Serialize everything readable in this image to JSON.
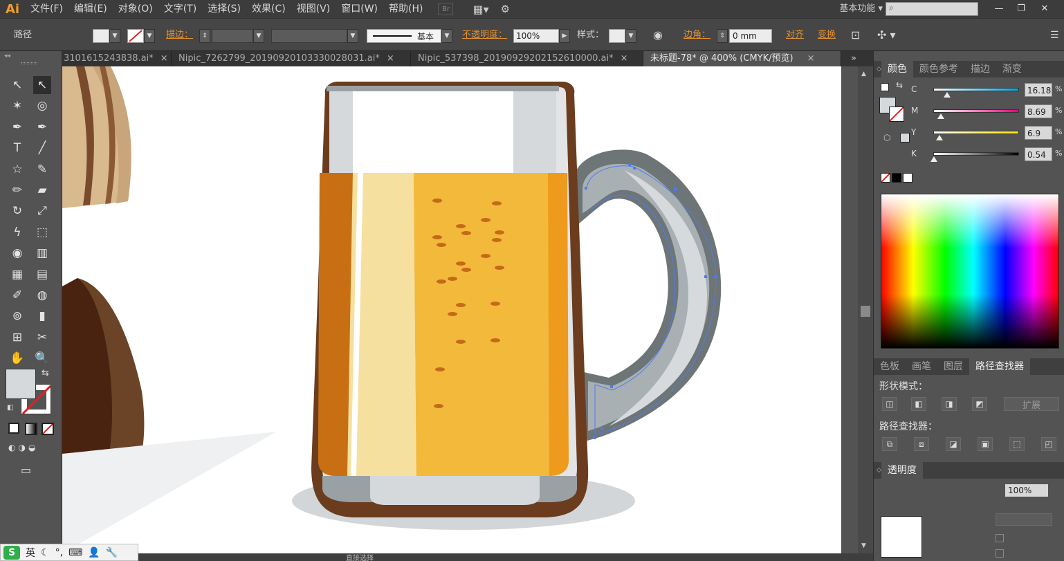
{
  "app": {
    "logo": "Ai",
    "workspace": "基本功能"
  },
  "menu": [
    {
      "label": "文件(F)"
    },
    {
      "label": "编辑(E)"
    },
    {
      "label": "对象(O)"
    },
    {
      "label": "文字(T)"
    },
    {
      "label": "选择(S)"
    },
    {
      "label": "效果(C)"
    },
    {
      "label": "视图(V)"
    },
    {
      "label": "窗口(W)"
    },
    {
      "label": "帮助(H)"
    }
  ],
  "menu_tool_br": "Br",
  "window_controls": {
    "minimize": "—",
    "restore": "❐",
    "close": "✕"
  },
  "control_bar": {
    "selection_label": "路径",
    "stroke_label": "描边：",
    "stroke_style": "基本",
    "opacity_label": "不透明度：",
    "opacity_value": "100%",
    "style_label": "样式：",
    "corner_label": "边角：",
    "corner_value": "0 mm",
    "align_label": "对齐",
    "transform_label": "变换"
  },
  "tabs": [
    {
      "label": "3101615243838.ai*",
      "close": "×"
    },
    {
      "label": "Nipic_7262799_20190920103330028031.ai*",
      "close": "×"
    },
    {
      "label": "Nipic_537398_20190929202152610000.ai*",
      "close": "×"
    },
    {
      "label": "未标题-78* @ 400% (CMYK/预览)",
      "close": "×",
      "active": true
    }
  ],
  "tools": [
    {
      "name": "selection-tool-icon",
      "glyph": "↖"
    },
    {
      "name": "direct-selection-tool-icon",
      "glyph": "↖"
    },
    {
      "name": "magic-wand-tool-icon",
      "glyph": "✶"
    },
    {
      "name": "lasso-tool-icon",
      "glyph": "◎"
    },
    {
      "name": "pen-tool-icon",
      "glyph": "✒"
    },
    {
      "name": "curvature-tool-icon",
      "glyph": "✒"
    },
    {
      "name": "type-tool-icon",
      "glyph": "T"
    },
    {
      "name": "line-tool-icon",
      "glyph": "╱"
    },
    {
      "name": "star-tool-icon",
      "glyph": "☆"
    },
    {
      "name": "paintbrush-tool-icon",
      "glyph": "✎"
    },
    {
      "name": "pencil-tool-icon",
      "glyph": "✏"
    },
    {
      "name": "eraser-tool-icon",
      "glyph": "▰"
    },
    {
      "name": "rotate-tool-icon",
      "glyph": "↻"
    },
    {
      "name": "scale-tool-icon",
      "glyph": "⤢"
    },
    {
      "name": "width-tool-icon",
      "glyph": "ϟ"
    },
    {
      "name": "free-transform-tool-icon",
      "glyph": "⬚"
    },
    {
      "name": "shape-builder-tool-icon",
      "glyph": "◉"
    },
    {
      "name": "graph-tool-icon",
      "glyph": "▥"
    },
    {
      "name": "mesh-tool-icon",
      "glyph": "▦"
    },
    {
      "name": "gradient-tool-icon",
      "glyph": "▤"
    },
    {
      "name": "eyedropper-tool-icon",
      "glyph": "✐"
    },
    {
      "name": "blend-tool-icon",
      "glyph": "◍"
    },
    {
      "name": "symbol-sprayer-tool-icon",
      "glyph": "⊚"
    },
    {
      "name": "column-graph-tool-icon",
      "glyph": "▮"
    },
    {
      "name": "artboard-tool-icon",
      "glyph": "⊞"
    },
    {
      "name": "slice-tool-icon",
      "glyph": "✂"
    },
    {
      "name": "hand-tool-icon",
      "glyph": "✋"
    },
    {
      "name": "zoom-tool-icon",
      "glyph": "🔍"
    }
  ],
  "color_panel": {
    "tabs": [
      "颜色",
      "颜色参考",
      "描边",
      "渐变"
    ],
    "active_tab": "颜色",
    "channels": [
      {
        "label": "C",
        "value": "16.18",
        "fraction": 0.16,
        "gradient": "linear-gradient(to right,#fff,#00a6e6)"
      },
      {
        "label": "M",
        "value": "8.69",
        "fraction": 0.09,
        "gradient": "linear-gradient(to right,#fff,#e6007e)"
      },
      {
        "label": "Y",
        "value": "6.9",
        "fraction": 0.07,
        "gradient": "linear-gradient(to right,#fff,#ffe600)"
      },
      {
        "label": "K",
        "value": "0.54",
        "fraction": 0.01,
        "gradient": "linear-gradient(to right,#fff,#000)"
      }
    ],
    "pct": "%"
  },
  "pathfinder_panel": {
    "tabs": [
      "色板",
      "画笔",
      "图层",
      "路径查找器"
    ],
    "active_tab": "路径查找器",
    "shape_modes_label": "形状模式：",
    "pathfinders_label": "路径查找器：",
    "expand_label": "扩展"
  },
  "transparency_panel": {
    "title": "透明度",
    "opacity": "100%"
  },
  "status": {
    "text": "直接选择"
  },
  "ime": {
    "logo": "S",
    "lang": "英"
  },
  "colors": {
    "beer_dark": "#c86f14",
    "beer_mid": "#ee9a1c",
    "beer_light": "#f6e0a0",
    "beer_center": "#f3b93a",
    "glass_rim": "#d6d9dc",
    "glass_outline": "#6b3d1e",
    "handle_gray": "#6e7577",
    "handle_light": "#d7dadc",
    "shadow": "#d3d6d8",
    "bubble": "#c46a18",
    "barrel_dark": "#4a2310",
    "barrel_mid": "#7a4a2c",
    "barrel_light": "#d9b98e"
  }
}
